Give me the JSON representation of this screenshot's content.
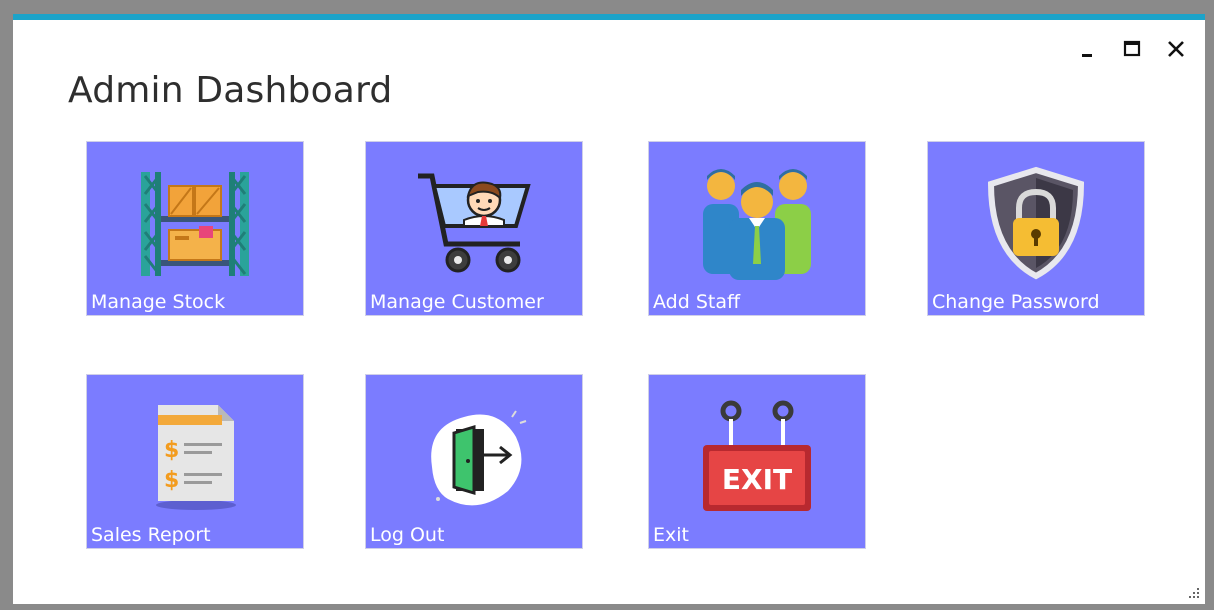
{
  "window": {
    "title": "Admin Dashboard",
    "controls": [
      "minimize",
      "maximize",
      "close"
    ]
  },
  "tiles": [
    {
      "label": "Manage Stock",
      "icon": "warehouse-shelf-icon"
    },
    {
      "label": "Manage Customer",
      "icon": "shopping-cart-customer-icon"
    },
    {
      "label": "Add Staff",
      "icon": "staff-group-icon"
    },
    {
      "label": "Change Password",
      "icon": "shield-lock-icon"
    },
    {
      "label": "Sales Report",
      "icon": "sales-report-icon"
    },
    {
      "label": "Log Out",
      "icon": "logout-door-icon"
    },
    {
      "label": "Exit",
      "icon": "exit-sign-icon"
    }
  ],
  "colors": {
    "tile": "#7b7cff",
    "accent": "#1ca3c9",
    "window_border": "#8a8a8a"
  }
}
